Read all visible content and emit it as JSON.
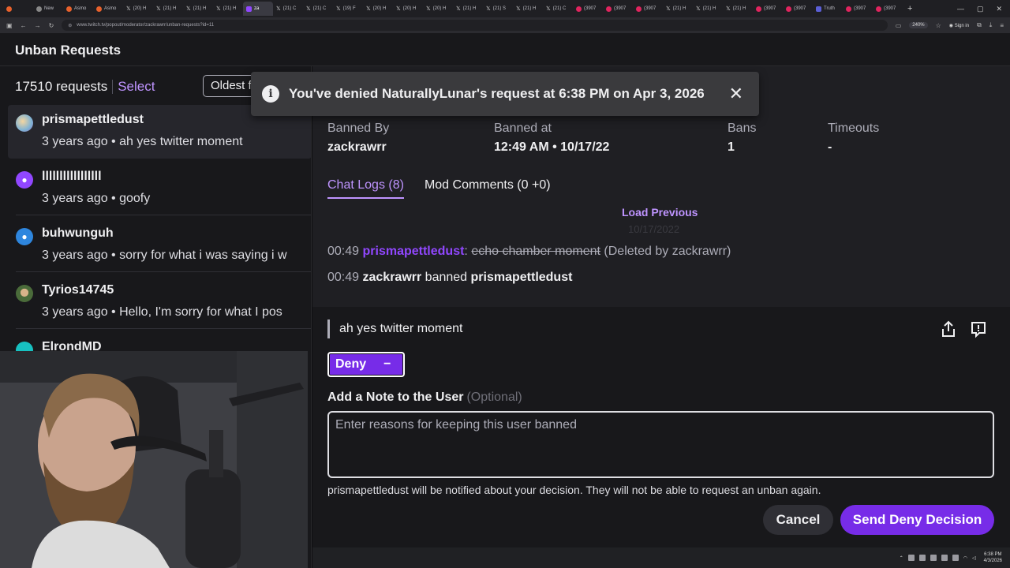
{
  "browser": {
    "tabs": [
      {
        "label": "",
        "icon": "shield-icon",
        "kind": "or"
      },
      {
        "label": "New",
        "icon": "page-icon",
        "kind": ""
      },
      {
        "label": "Asmo",
        "icon": "page-icon",
        "kind": "or"
      },
      {
        "label": "Asmo",
        "icon": "page-icon",
        "kind": "or"
      },
      {
        "label": "(20) H",
        "icon": "x-icon",
        "kind": "x"
      },
      {
        "label": "(21) H",
        "icon": "x-icon",
        "kind": "x"
      },
      {
        "label": "(21) H",
        "icon": "x-icon",
        "kind": "x"
      },
      {
        "label": "(21) H",
        "icon": "x-icon",
        "kind": "x"
      },
      {
        "label": "za",
        "icon": "twitch-icon",
        "kind": "tw",
        "active": true
      },
      {
        "label": "(21) C",
        "icon": "x-icon",
        "kind": "x"
      },
      {
        "label": "(21) C",
        "icon": "x-icon",
        "kind": "x"
      },
      {
        "label": "(19) F",
        "icon": "x-icon",
        "kind": "x"
      },
      {
        "label": "(20) H",
        "icon": "x-icon",
        "kind": "x"
      },
      {
        "label": "(20) H",
        "icon": "x-icon",
        "kind": "x"
      },
      {
        "label": "(20) H",
        "icon": "x-icon",
        "kind": "x"
      },
      {
        "label": "(21) H",
        "icon": "x-icon",
        "kind": "x"
      },
      {
        "label": "(21) S",
        "icon": "x-icon",
        "kind": "x"
      },
      {
        "label": "(21) H",
        "icon": "x-icon",
        "kind": "x"
      },
      {
        "label": "(21) C",
        "icon": "x-icon",
        "kind": "x"
      },
      {
        "label": "(3907",
        "icon": "youtube-icon",
        "kind": "yt"
      },
      {
        "label": "(3907",
        "icon": "youtube-icon",
        "kind": "yt"
      },
      {
        "label": "(3907",
        "icon": "youtube-icon",
        "kind": "yt"
      },
      {
        "label": "(21) H",
        "icon": "x-icon",
        "kind": "x"
      },
      {
        "label": "(21) H",
        "icon": "x-icon",
        "kind": "x"
      },
      {
        "label": "(21) H",
        "icon": "x-icon",
        "kind": "x"
      },
      {
        "label": "(3907",
        "icon": "youtube-icon",
        "kind": "yt"
      },
      {
        "label": "(3907",
        "icon": "youtube-icon",
        "kind": "yt"
      },
      {
        "label": "Truth",
        "icon": "truth-icon",
        "kind": "tr"
      },
      {
        "label": "(3907",
        "icon": "youtube-icon",
        "kind": "yt"
      },
      {
        "label": "(3907",
        "icon": "youtube-icon",
        "kind": "yt"
      }
    ],
    "url": "www.twitch.tv/popout/moderator/zackrawrr/unban-requests?id=11",
    "zoom": "240%",
    "signin": "Sign in"
  },
  "header": {
    "title": "Unban Requests"
  },
  "list": {
    "count": "17510 requests",
    "select": "Select",
    "sort": "Oldest f",
    "items": [
      {
        "name": "prismapettledust",
        "meta": "3 years ago • ah yes twitter moment",
        "avatar_color": "#7fb3d5"
      },
      {
        "name": "lllllllllllllllll",
        "meta": "3 years ago • goofy",
        "avatar_color": "#9147ff"
      },
      {
        "name": "buhwunguh",
        "meta": "3 years ago • sorry for what i was saying i w",
        "avatar_color": "#2e86de"
      },
      {
        "name": "Tyrios14745",
        "meta": "3 years ago • Hello, I'm sorry for what I pos",
        "avatar_color": "#6b8e4e"
      },
      {
        "name": "ElrondMD",
        "meta": "",
        "avatar_color": "#17c1c1"
      }
    ]
  },
  "toast": {
    "message": "You've denied NaturallyLunar's request at 6:38 PM on Apr 3, 2026"
  },
  "detail": {
    "stats": [
      {
        "label": "Banned By",
        "value": "zackrawrr"
      },
      {
        "label": "Banned at",
        "value": "12:49 AM • 10/17/22"
      },
      {
        "label": "Bans",
        "value": "1"
      },
      {
        "label": "Timeouts",
        "value": "-"
      }
    ],
    "tabs": {
      "chat_logs": "Chat Logs (8)",
      "mod_comments": "Mod Comments (0 +0)"
    },
    "load_previous": "Load Previous",
    "ghost_date": "10/17/2022",
    "log1": {
      "time": "00:49",
      "user": "prismapettledust",
      "colon": ":",
      "message": "echo chamber moment",
      "note": "(Deleted by zackrawrr)"
    },
    "log2": {
      "time": "00:49",
      "actor": "zackrawrr",
      "action": "banned",
      "target": "prismapettledust"
    }
  },
  "request": {
    "message": "ah yes twitter moment",
    "decision_label": "Deny",
    "decision_symbol": "−",
    "note_label": "Add a Note to the User",
    "note_optional": "(Optional)",
    "note_placeholder": "Enter reasons for keeping this user banned",
    "notice": "prismapettledust will be notified about your decision. They will not be able to request an unban again.",
    "cancel": "Cancel",
    "send": "Send Deny Decision"
  },
  "taskbar": {
    "time": "6:38 PM",
    "date": "4/3/2026"
  },
  "colors": {
    "accent": "#9147ff",
    "accent_dark": "#772ce8",
    "link": "#bf94ff",
    "bg": "#18181b"
  }
}
